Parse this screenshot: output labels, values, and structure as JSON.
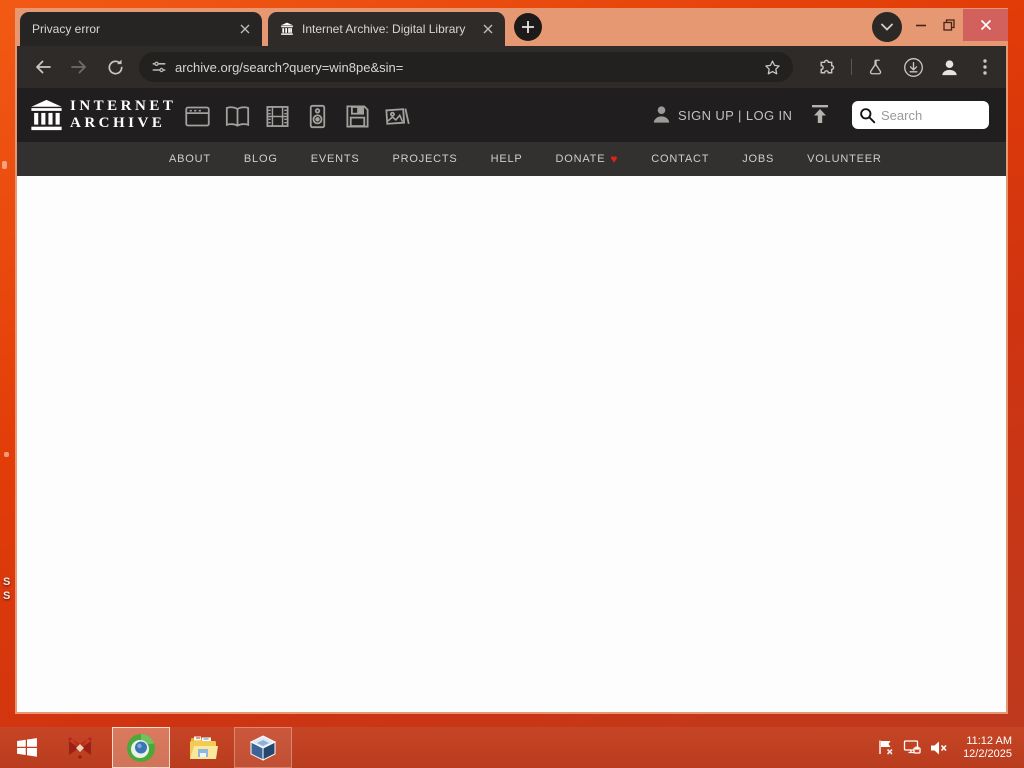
{
  "colors": {
    "titlebar": "#e69872",
    "toolbar_bg": "#2e2b29",
    "header_bg": "#201e1e",
    "nav_bg": "#333130",
    "taskbar_bg": "#c64526",
    "close_button": "#d2605d",
    "donate_heart": "#e0211b",
    "desktop_top": "#f25a14",
    "desktop_bottom": "#bc3a20"
  },
  "browser": {
    "tabs": [
      {
        "title": "Privacy error"
      },
      {
        "title": "Internet Archive: Digital Library"
      }
    ],
    "new_tab_glyph": "+",
    "url": "archive.org/search?query=win8pe&sin=",
    "toolbar_icons": [
      "back",
      "forward",
      "reload",
      "site-settings",
      "bookmark-star",
      "extensions",
      "labs-flask",
      "downloads",
      "profile",
      "menu-kebab"
    ],
    "titlebar_icons": [
      "tab-search-chevron",
      "minimize",
      "maximize-restore",
      "close"
    ]
  },
  "ia": {
    "wordmark_line1": "INTERNET",
    "wordmark_line2": "ARCHIVE",
    "media_icons": [
      "web",
      "texts",
      "video",
      "audio",
      "software",
      "images"
    ],
    "auth": "SIGN UP | LOG IN",
    "search_placeholder": "Search",
    "header_icons": [
      "ia-building-logo",
      "person",
      "upload-arrow",
      "magnifier"
    ]
  },
  "nav": {
    "items": [
      "ABOUT",
      "BLOG",
      "EVENTS",
      "PROJECTS",
      "HELP",
      "DONATE",
      "CONTACT",
      "JOBS",
      "VOLUNTEER"
    ],
    "donate_heart": "♥"
  },
  "desktop": {
    "fragments": [
      "S",
      "S"
    ]
  },
  "taskbar": {
    "icons": [
      "start-windows-logo",
      "red-app",
      "chromium-browser",
      "file-explorer",
      "virtualbox",
      "action-center-flag",
      "network-status",
      "volume-muted"
    ],
    "clock": {
      "time": "11:12 AM",
      "date": "12/2/2025"
    }
  }
}
